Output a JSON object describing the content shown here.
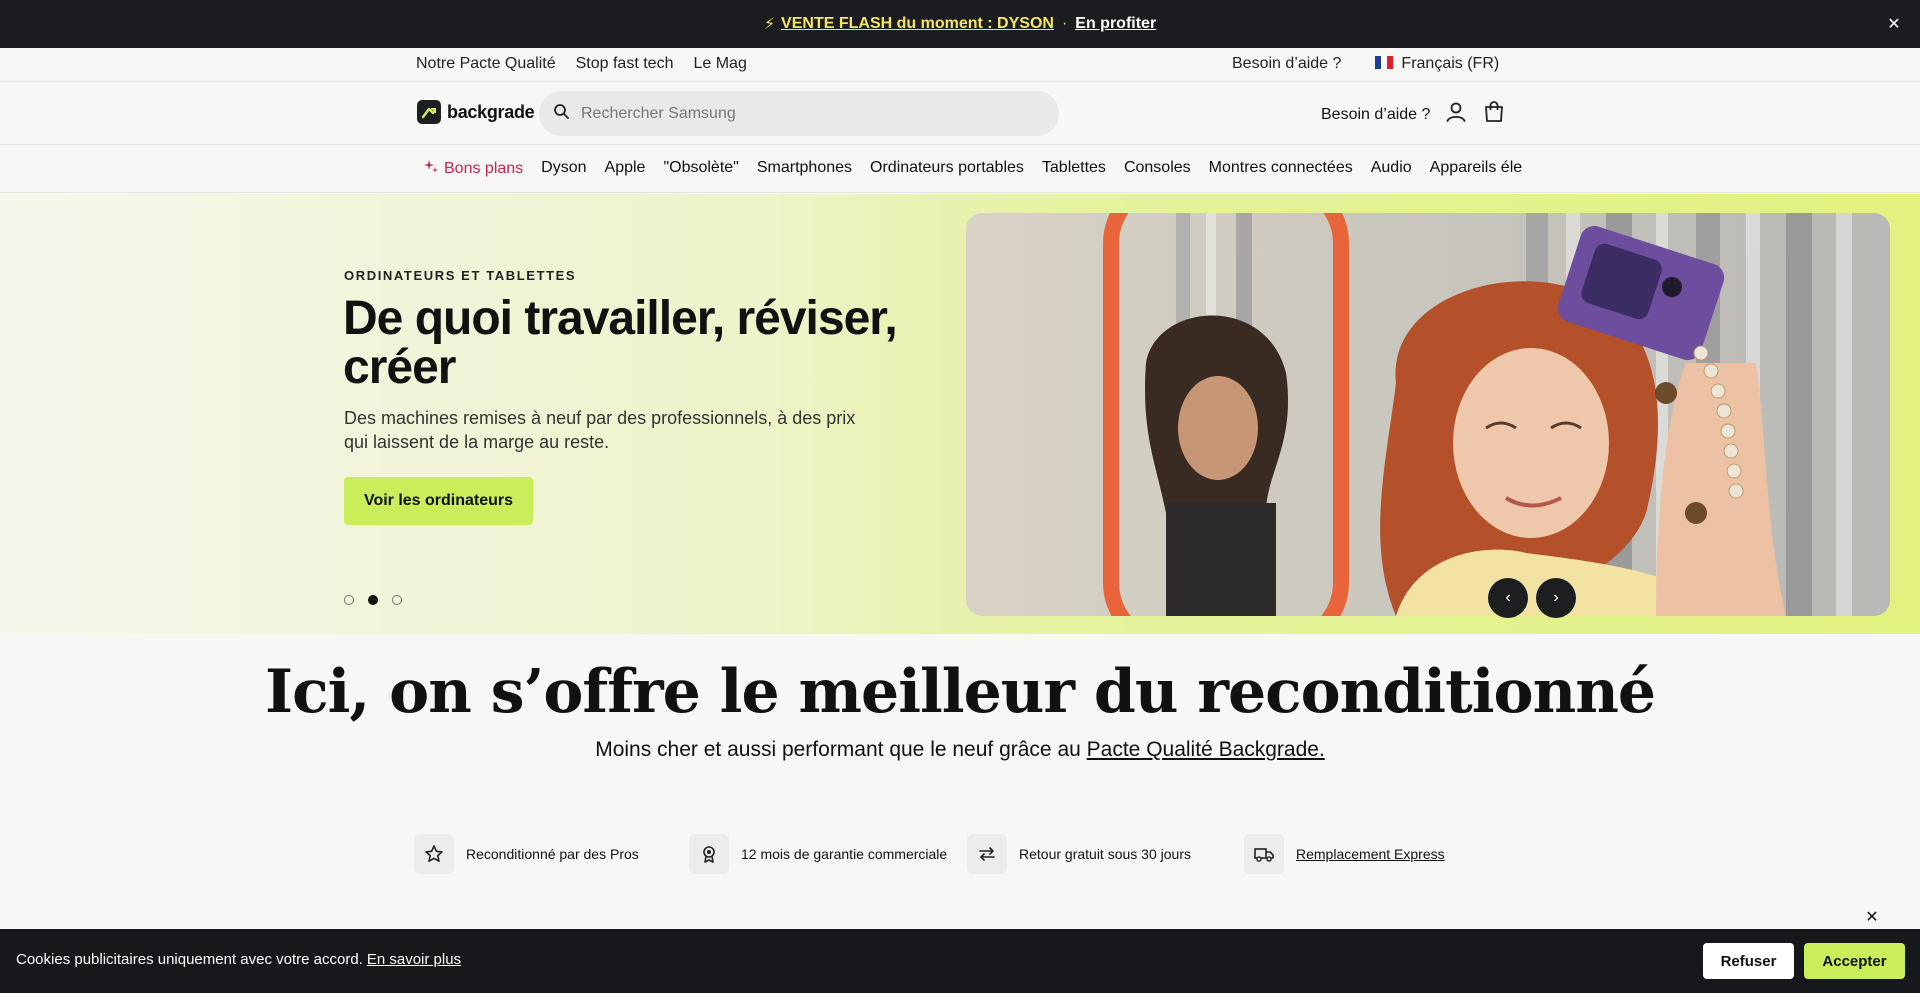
{
  "announcement": {
    "icon": "lightning-icon",
    "promo_text": "VENTE FLASH du moment : DYSON",
    "separator": "·",
    "cta": "En profiter",
    "close_icon": "close-icon"
  },
  "utility_nav": {
    "left_links": [
      "Notre Pacte Qualité",
      "Stop fast tech",
      "Le Mag"
    ],
    "help": "Besoin d’aide ?",
    "language": "Français (FR)"
  },
  "header": {
    "logo_text": "backgrade",
    "search_placeholder": "Rechercher Samsung",
    "help": "Besoin d’aide ?",
    "account_icon": "user-icon",
    "cart_icon": "cart-icon"
  },
  "categories": {
    "deals_label": "Bons plans",
    "items": [
      "Dyson",
      "Apple",
      "\"Obsolète\"",
      "Smartphones",
      "Ordinateurs portables",
      "Tablettes",
      "Consoles",
      "Montres connectées",
      "Audio",
      "Appareils électroménagers"
    ]
  },
  "hero": {
    "eyebrow": "ORDINATEURS ET TABLETTES",
    "title": "De quoi travailler, réviser, créer",
    "description": "Des machines remises à neuf par des professionnels, à des prix qui laissent de la marge au reste.",
    "cta": "Voir les ordinateurs",
    "slides_total": 3,
    "active_slide": 2
  },
  "tagline": {
    "title": "Ici, on s’offre le meilleur du reconditionné",
    "subtitle_prefix": "Moins cher et aussi performant que le neuf grâce au ",
    "subtitle_link": "Pacte Qualité Backgrade."
  },
  "features": [
    {
      "icon": "star-icon",
      "label": "Reconditionné par des Pros"
    },
    {
      "icon": "award-icon",
      "label": "12 mois de garantie commerciale"
    },
    {
      "icon": "arrows-swap-icon",
      "label": "Retour gratuit sous 30 jours"
    },
    {
      "icon": "truck-icon",
      "label": "Remplacement Express"
    }
  ],
  "cookie": {
    "message": "Cookies publicitaires uniquement avec votre accord.",
    "link": "En savoir plus",
    "refuse": "Refuser",
    "accept": "Accepter"
  },
  "colors": {
    "accent_green": "#c9ee5a",
    "dark": "#1c1d20",
    "deals_red": "#c1274f"
  }
}
